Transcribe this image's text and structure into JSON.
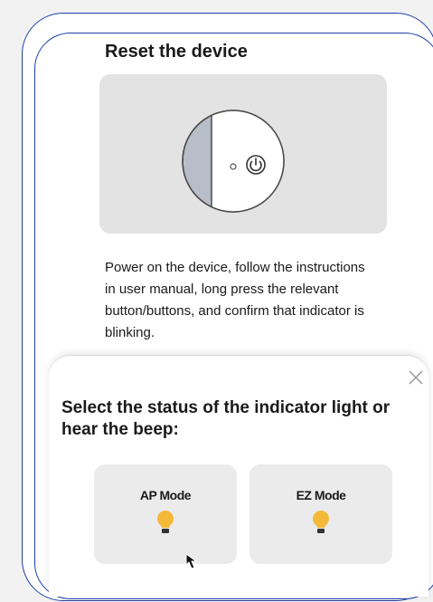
{
  "header": {
    "title": "Reset the device"
  },
  "illustration": {
    "icon": "device-power-button-illustration"
  },
  "instructions": {
    "text": "Power on the device, follow the instructions in user manual, long press the relevant button/buttons, and confirm that indicator is blinking."
  },
  "sheet": {
    "close_icon": "close-icon",
    "title": "Select the status of the indicator light or hear the beep:",
    "modes": [
      {
        "label": "AP Mode",
        "icon": "bulb-icon"
      },
      {
        "label": "EZ Mode",
        "icon": "bulb-icon"
      }
    ]
  },
  "colors": {
    "frame": "#1d3fa8",
    "bulb": "#f5b93a",
    "card": "#ebebeb",
    "illustration_bg": "#e3e3e3",
    "device_ring": "#b8bec8"
  }
}
